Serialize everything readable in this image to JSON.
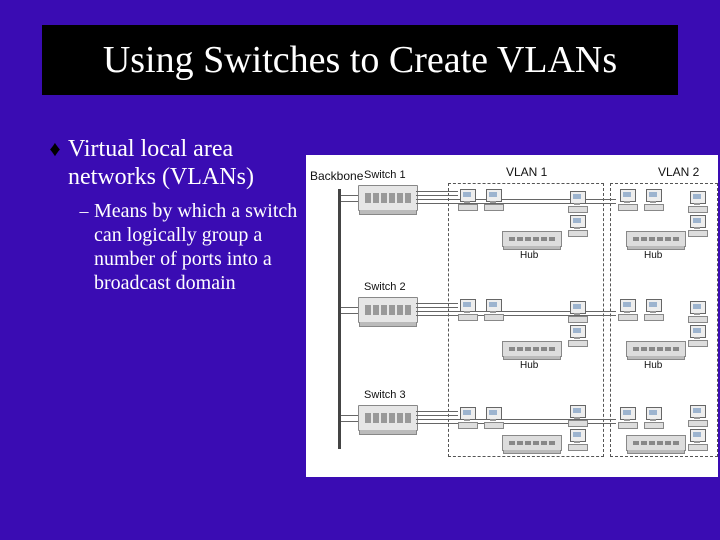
{
  "title": "Using Switches to Create VLANs",
  "bullet": {
    "text": "Virtual local area networks (VLANs)"
  },
  "sub": {
    "text": "Means by which a switch can logically group a number of ports into a broadcast domain"
  },
  "diagram": {
    "backbone": "Backbone",
    "vlan1": "VLAN 1",
    "vlan2": "VLAN 2",
    "switch1": "Switch 1",
    "switch2": "Switch 2",
    "switch3": "Switch 3",
    "hub": "Hub"
  }
}
